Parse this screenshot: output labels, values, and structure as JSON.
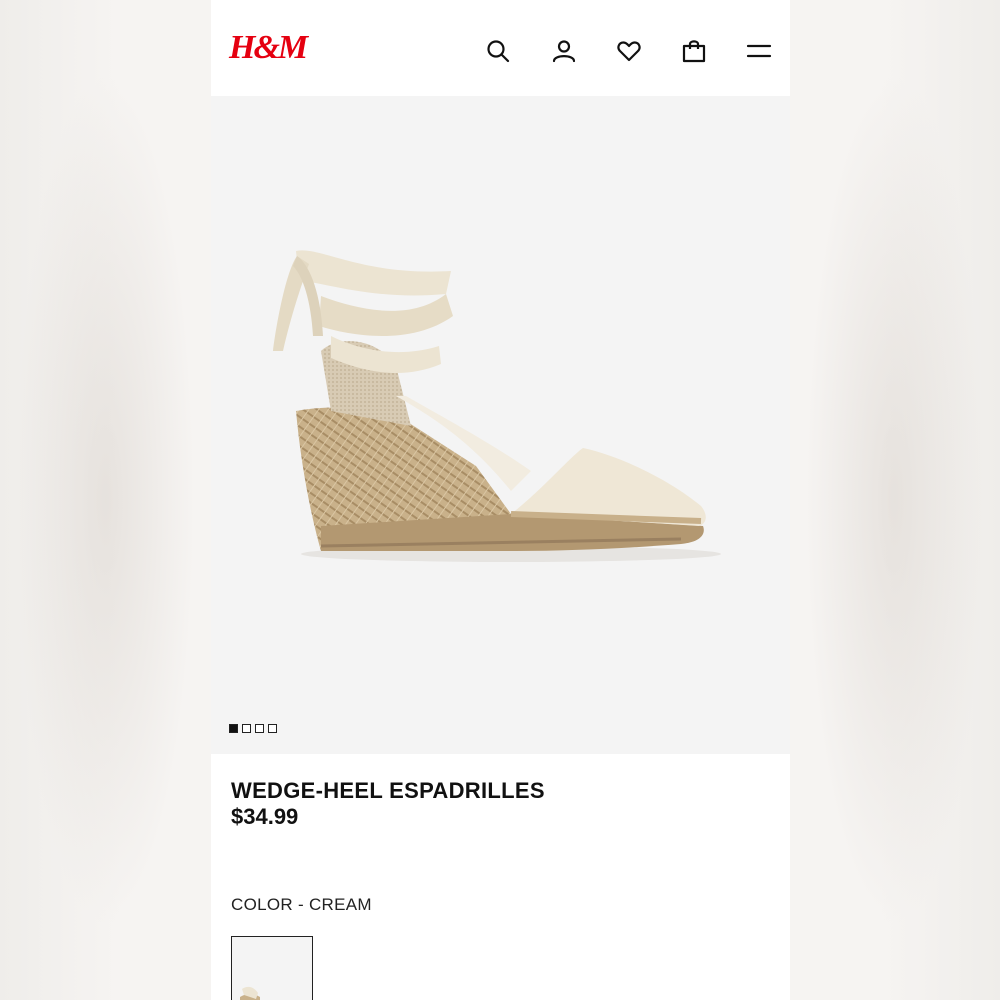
{
  "header": {
    "logo": "H&M",
    "icons": [
      "search-icon",
      "account-icon",
      "heart-icon",
      "bag-icon",
      "menu-icon"
    ]
  },
  "gallery": {
    "image_count": 4,
    "active_index": 0
  },
  "product": {
    "title": "WEDGE-HEEL ESPADRILLES",
    "price": "$34.99",
    "color_label": "COLOR - CREAM"
  },
  "colors": {
    "brand": "#e50010",
    "text": "#111111",
    "gallery_bg": "#f4f4f4"
  }
}
